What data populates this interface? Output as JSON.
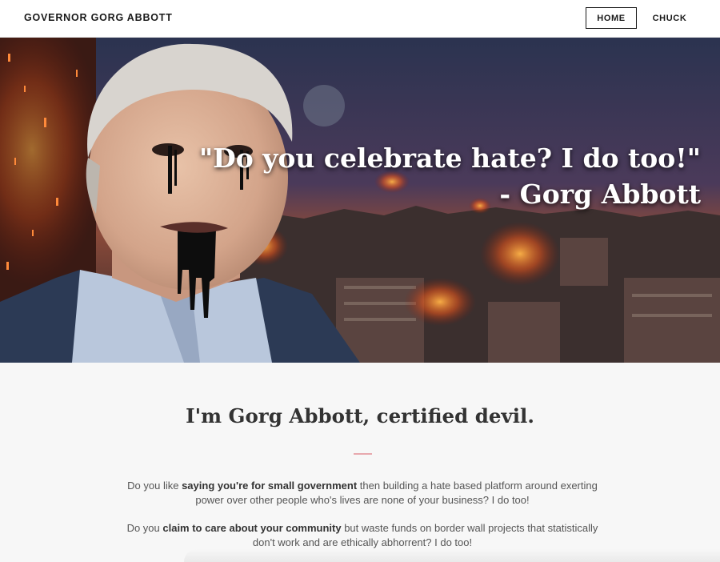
{
  "header": {
    "site_title": "GOVERNOR GORG ABBOTT",
    "nav": {
      "home_label": "HOME",
      "chuck_label": "CHUCK"
    }
  },
  "hero": {
    "quote_line1": "\"Do you celebrate hate? I do too!\"",
    "quote_line2": "- Gorg Abbott"
  },
  "main": {
    "headline": "I'm Gorg Abbott, certified devil.",
    "p1_pre": "Do you like ",
    "p1_bold": "saying you're for small government",
    "p1_post": " then building a hate based platform around exerting power over other people who's lives are none of your business? I do too!",
    "p2_pre": "Do you ",
    "p2_bold": "claim to care about your community",
    "p2_post": " but waste funds on border wall projects that statistically don't work and are ethically abhorrent? I do too!"
  },
  "colors": {
    "divider": "#e8a9ae",
    "text": "#555555",
    "header_bg": "#ffffff"
  }
}
